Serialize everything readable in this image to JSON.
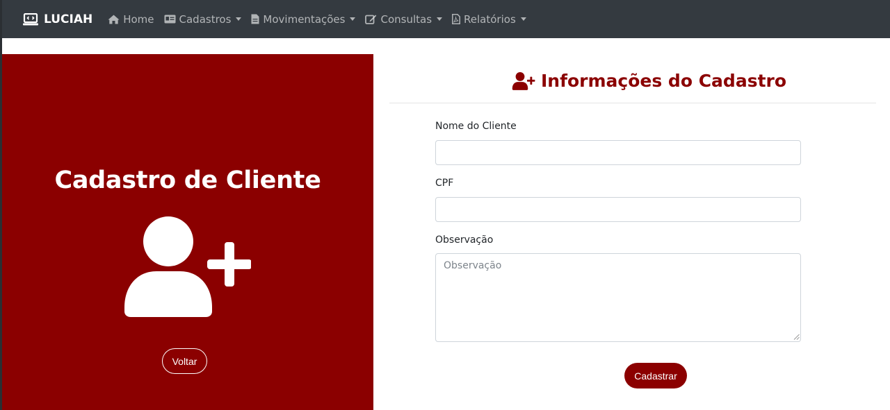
{
  "navbar": {
    "brand": "LUCIAH",
    "items": [
      {
        "label": "Home",
        "icon": "home-icon",
        "dropdown": false
      },
      {
        "label": "Cadastros",
        "icon": "id-card-icon",
        "dropdown": true
      },
      {
        "label": "Movimentações",
        "icon": "file-icon",
        "dropdown": true
      },
      {
        "label": "Consultas",
        "icon": "edit-icon",
        "dropdown": true
      },
      {
        "label": "Relatórios",
        "icon": "file-pdf-icon",
        "dropdown": true
      }
    ]
  },
  "left_panel": {
    "title": "Cadastro de Cliente",
    "back_label": "Voltar",
    "color": "#8b0000"
  },
  "form": {
    "title": "Informações do Cadastro",
    "fields": {
      "nome": {
        "label": "Nome do Cliente",
        "value": "",
        "placeholder": ""
      },
      "cpf": {
        "label": "CPF",
        "value": "",
        "placeholder": ""
      },
      "observacao": {
        "label": "Observação",
        "value": "",
        "placeholder": "Observação"
      }
    },
    "submit_label": "Cadastrar"
  },
  "colors": {
    "navbar_bg": "#343a40",
    "accent": "#8b0000"
  }
}
